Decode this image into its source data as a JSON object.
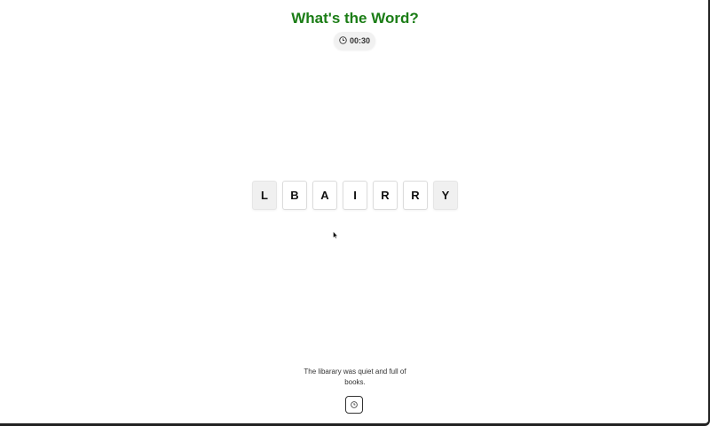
{
  "header": {
    "title": "What's the Word?"
  },
  "timer": {
    "icon": "clock-icon",
    "value": "00:30"
  },
  "tiles": [
    {
      "letter": "L",
      "faded": true
    },
    {
      "letter": "B",
      "faded": false
    },
    {
      "letter": "A",
      "faded": false
    },
    {
      "letter": "I",
      "faded": false
    },
    {
      "letter": "R",
      "faded": false
    },
    {
      "letter": "R",
      "faded": false
    },
    {
      "letter": "Y",
      "faded": true
    }
  ],
  "hint": {
    "sentence": "The libarary was quiet and full of books.",
    "button_icon": "clock-icon"
  },
  "colors": {
    "title": "#1b7d16",
    "tile_border": "#dcdcdc",
    "faded_tile_bg": "#f0f0f0"
  }
}
